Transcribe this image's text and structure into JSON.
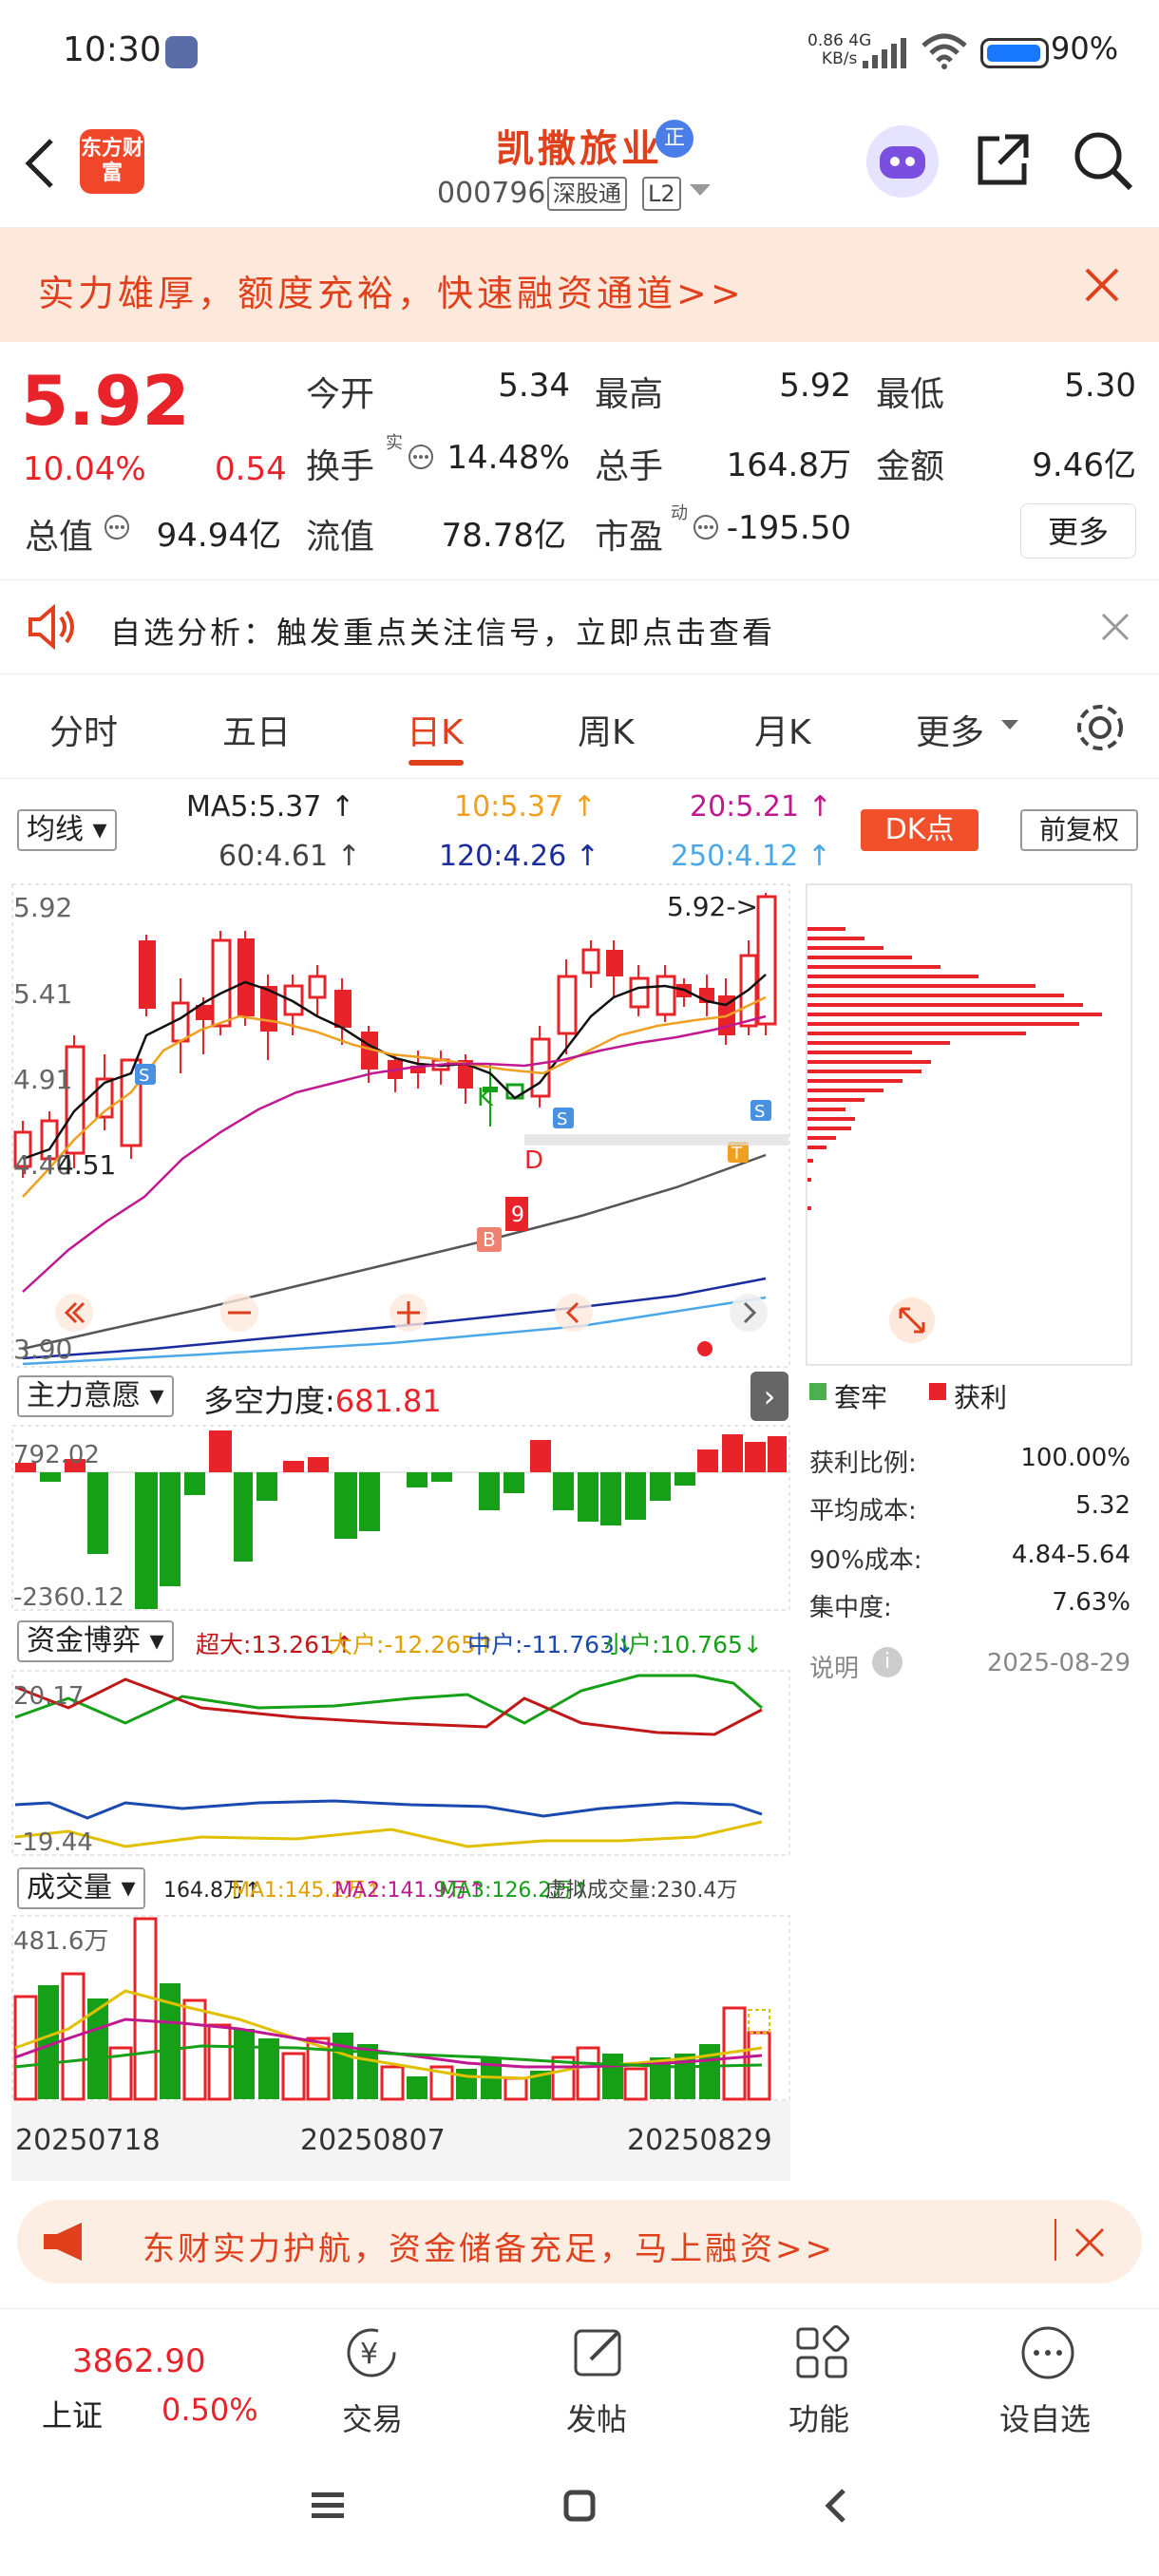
{
  "status_bar": {
    "time": "10:30",
    "net_speed_value": "0.86",
    "net_speed_unit": "KB/s",
    "network": "4G",
    "battery": "90%"
  },
  "header": {
    "app_logo_text": "东方财富",
    "stock_name": "凯撒旅业",
    "badge": "正",
    "stock_code": "000796",
    "tag1": "深股通",
    "tag2": "L2"
  },
  "promo_banner": {
    "text": "实力雄厚，额度充裕，快速融资通道>>"
  },
  "quote": {
    "price": "5.92",
    "change_pct": "10.04%",
    "change": "0.54",
    "open_label": "今开",
    "open": "5.34",
    "high_label": "最高",
    "high": "5.92",
    "low_label": "最低",
    "low": "5.30",
    "turnover_label": "换手",
    "turnover": "14.48%",
    "volume_label": "总手",
    "volume": "164.8万",
    "amount_label": "金额",
    "amount": "9.46亿",
    "mcap_label": "总值",
    "mcap": "94.94亿",
    "float_label": "流值",
    "float_mcap": "78.78亿",
    "pe_label": "市盈",
    "pe": "-195.50",
    "more_label": "更多",
    "real_sup": "实",
    "dyn_sup": "动"
  },
  "notice": {
    "text": "自选分析：触发重点关注信号，立即点击查看"
  },
  "tabs": [
    "分时",
    "五日",
    "日K",
    "周K",
    "月K",
    "更多"
  ],
  "active_tab": "日K",
  "ma": {
    "selector": "均线",
    "ma5": "MA5:5.37",
    "ma10": "10:5.37",
    "ma20": "20:5.21",
    "ma60": "60:4.61",
    "ma120": "120:4.26",
    "ma250": "250:4.12"
  },
  "buttons": {
    "dk": "DK点",
    "adjust": "前复权"
  },
  "kline": {
    "price_top": "5.92",
    "price_mid": "5.41",
    "price_low": "4.91",
    "price_lower": "4.40",
    "price_bottom": "3.90",
    "marker_high": "5.92->",
    "marker_low": "4.51"
  },
  "force": {
    "selector": "主力意愿",
    "label": "多空力度:",
    "value": "681.81",
    "top": "792.02",
    "bottom": "-2360.12"
  },
  "funds": {
    "selector": "资金博弈",
    "super": "超大:13.261",
    "large": "大户:-12.265",
    "mid": "中户:-11.763",
    "small": "小户:10.765",
    "top": "20.17",
    "bottom": "-19.44"
  },
  "volume": {
    "selector": "成交量",
    "total": "164.8万",
    "ma1": "MA1:145.2万",
    "ma2": "MA2:141.9万",
    "ma3": "MA3:126.2万",
    "virtual": "虚拟成交量:230.4万",
    "top": "481.6万"
  },
  "dates": [
    "20250718",
    "20250807",
    "20250829"
  ],
  "chip": {
    "trapped": "套牢",
    "profit": "获利",
    "profit_ratio_label": "获利比例:",
    "profit_ratio": "100.00%",
    "avg_cost_label": "平均成本:",
    "avg_cost": "5.32",
    "cost90_label": "90%成本:",
    "cost90": "4.84-5.64",
    "concentration_label": "集中度:",
    "concentration": "7.63%",
    "note_label": "说明",
    "date": "2025-08-29"
  },
  "promo_banner2": {
    "text": "东财实力护航，资金储备充足，马上融资>>"
  },
  "bottom_nav": {
    "index_value": "3862.90",
    "index_name": "上证",
    "index_pct": "0.50%",
    "trade": "交易",
    "post": "发帖",
    "func": "功能",
    "watch": "设自选"
  },
  "colors": {
    "up": "#e8232a",
    "down": "#16a018",
    "accent": "#e0401c"
  }
}
